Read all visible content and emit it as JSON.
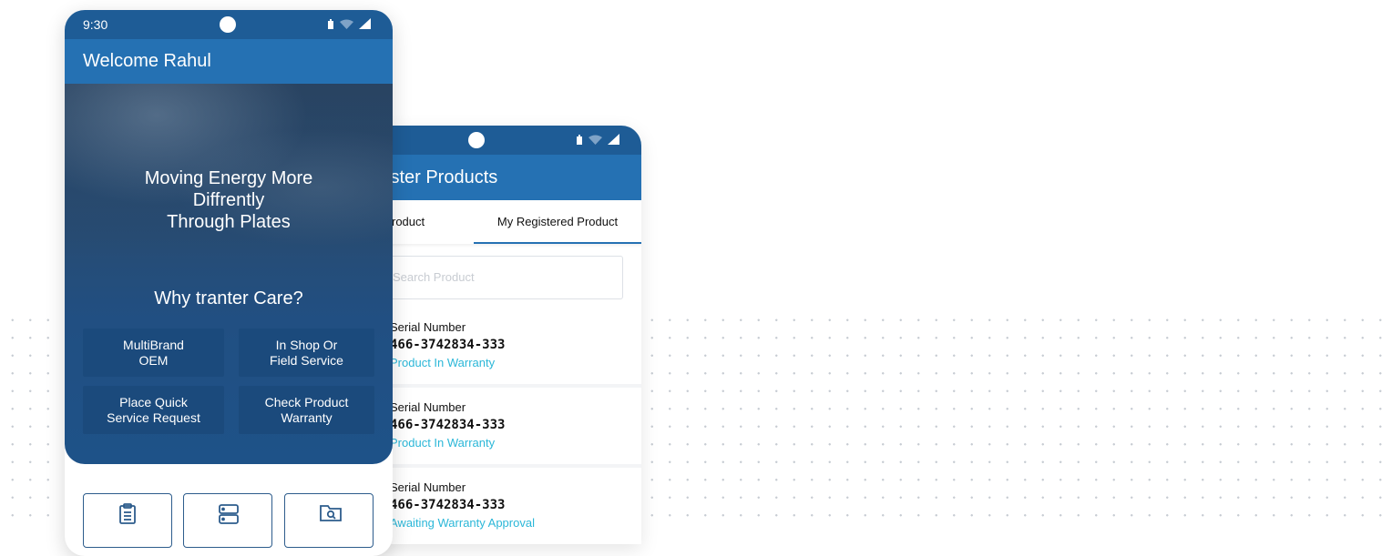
{
  "colors": {
    "status_bar": "#1e5c96",
    "app_bar": "#2571b3",
    "accent_text": "#2bb7d8",
    "feature_button": "#1b4a7c"
  },
  "phone_home": {
    "status": {
      "time": "9:30"
    },
    "header": {
      "title": "Welcome Rahul"
    },
    "hero": {
      "line1": "Moving  Energy More",
      "line2": "Diffrently",
      "line3": "Through Plates"
    },
    "section_title": "Why tranter Care?",
    "features": [
      {
        "line1": "MultiBrand",
        "line2": "OEM"
      },
      {
        "line1": "In Shop Or",
        "line2": "Field Service"
      },
      {
        "line1": "Place Quick",
        "line2": "Service Request"
      },
      {
        "line1": "Check Product",
        "line2": "Warranty"
      }
    ],
    "bottom_nav_icons": [
      "clipboard-icon",
      "server-icon",
      "folder-search-icon"
    ]
  },
  "phone_register": {
    "header": {
      "title": "ister Products"
    },
    "tabs": [
      {
        "label": "roduct"
      },
      {
        "label": "My Registered Product"
      }
    ],
    "search": {
      "placeholder": "Search Product"
    },
    "items": [
      {
        "label": "Serial Number",
        "number": "466-3742834-333",
        "status": "Product In Warranty"
      },
      {
        "label": "Serial Number",
        "number": "466-3742834-333",
        "status": "Product In Warranty"
      },
      {
        "label": "Serial Number",
        "number": "466-3742834-333",
        "status": "Awaiting Warranty Approval"
      }
    ]
  }
}
